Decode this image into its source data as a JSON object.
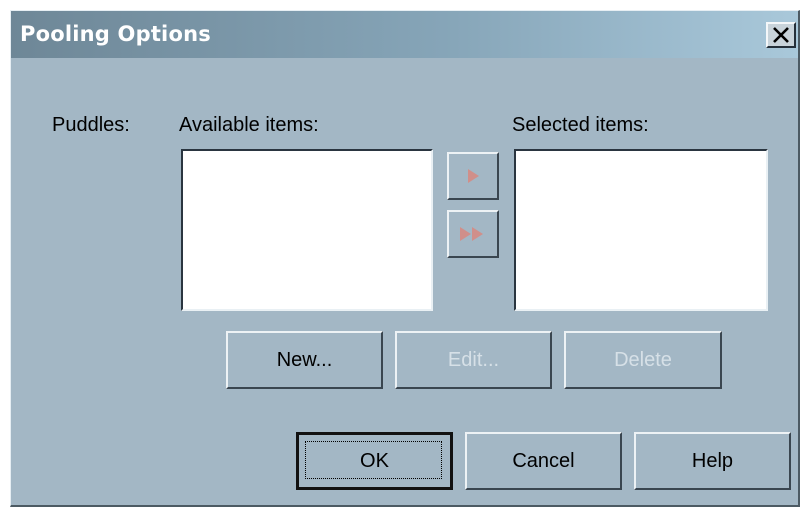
{
  "window": {
    "title": "Pooling Options",
    "close_glyph": "X"
  },
  "puddles": {
    "label": "Puddles:",
    "available_label": "Available items:",
    "selected_label": "Selected items:",
    "available_items": [],
    "selected_items": []
  },
  "transfer": {
    "add_icon": "triangle-right-icon",
    "add_all_icon": "double-triangle-right-icon"
  },
  "item_actions": {
    "new_label": "New...",
    "edit_label": "Edit...",
    "delete_label": "Delete"
  },
  "footer": {
    "ok_label": "OK",
    "cancel_label": "Cancel",
    "help_label": "Help"
  },
  "colors": {
    "dialog_bg": "#a3b7c5",
    "disabled_text": "#d6e0e7",
    "disabled_arrow": "#d08f8a"
  }
}
